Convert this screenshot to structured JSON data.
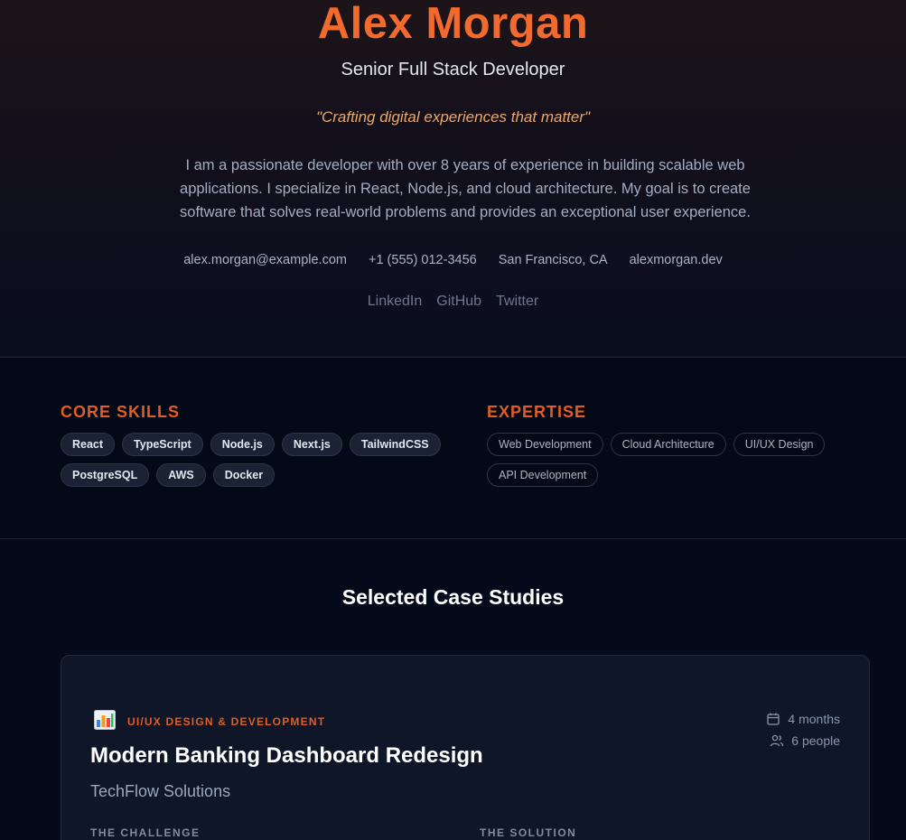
{
  "profile": {
    "name": "Alex Morgan",
    "title": "Senior Full Stack Developer",
    "tagline": "\"Crafting digital experiences that matter\"",
    "bio": "I am a passionate developer with over 8 years of experience in building scalable web applications. I specialize in React, Node.js, and cloud architecture. My goal is to create software that solves real-world problems and provides an exceptional user experience.",
    "contacts": [
      "alex.morgan@example.com",
      "+1 (555) 012-3456",
      "San Francisco, CA",
      "alexmorgan.dev"
    ],
    "socials": [
      "LinkedIn",
      "GitHub",
      "Twitter"
    ]
  },
  "skills": {
    "heading": "CORE SKILLS",
    "items": [
      "React",
      "TypeScript",
      "Node.js",
      "Next.js",
      "TailwindCSS",
      "PostgreSQL",
      "AWS",
      "Docker"
    ]
  },
  "expertise": {
    "heading": "EXPERTISE",
    "items": [
      "Web Development",
      "Cloud Architecture",
      "UI/UX Design",
      "API Development"
    ]
  },
  "case_studies": {
    "heading": "Selected Case Studies",
    "items": [
      {
        "icon": "bar-chart-icon",
        "category": "UI/UX DESIGN & DEVELOPMENT",
        "title": "Modern Banking Dashboard Redesign",
        "client": "TechFlow Solutions",
        "duration": "4 months",
        "team": "6 people",
        "challenge_label": "THE CHALLENGE",
        "solution_label": "THE SOLUTION"
      }
    ]
  },
  "colors": {
    "accent": "#f26a2e",
    "background": "#050a1a"
  }
}
